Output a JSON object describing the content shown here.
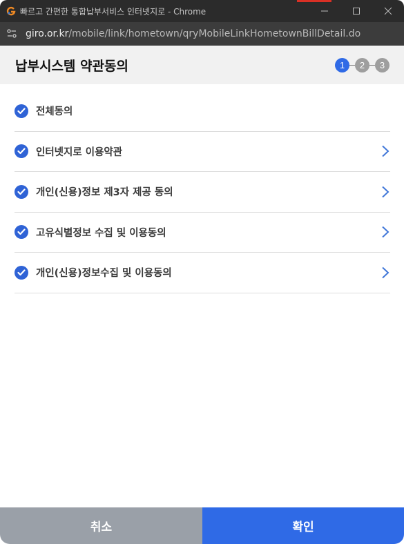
{
  "window": {
    "title": "빠르고 간편한 통합납부서비스 인터넷지로 - Chrome",
    "app_icon": "giro-g-icon"
  },
  "addressbar": {
    "host": "giro.or.kr",
    "path": "/mobile/link/hometown/qryMobileLinkHometownBillDetail.do",
    "site_icon": "site-settings-icon"
  },
  "header": {
    "title": "납부시스템 약관동의",
    "steps": [
      "1",
      "2",
      "3"
    ],
    "active_step": 1
  },
  "agreements": [
    {
      "label": "전체동의",
      "checked": true,
      "has_detail": false
    },
    {
      "label": "인터넷지로 이용약관",
      "checked": true,
      "has_detail": true
    },
    {
      "label": "개인(신용)정보 제3자 제공 동의",
      "checked": true,
      "has_detail": true
    },
    {
      "label": "고유식별정보 수집 및 이용동의",
      "checked": true,
      "has_detail": true
    },
    {
      "label": "개인(신용)정보수집 및 이용동의",
      "checked": true,
      "has_detail": true
    }
  ],
  "buttons": {
    "cancel": "취소",
    "confirm": "확인"
  },
  "colors": {
    "accent": "#2f6ae6",
    "check": "#2f63d6",
    "cancel_bg": "#9aa0a8",
    "header_bg": "#f1f1f1"
  }
}
